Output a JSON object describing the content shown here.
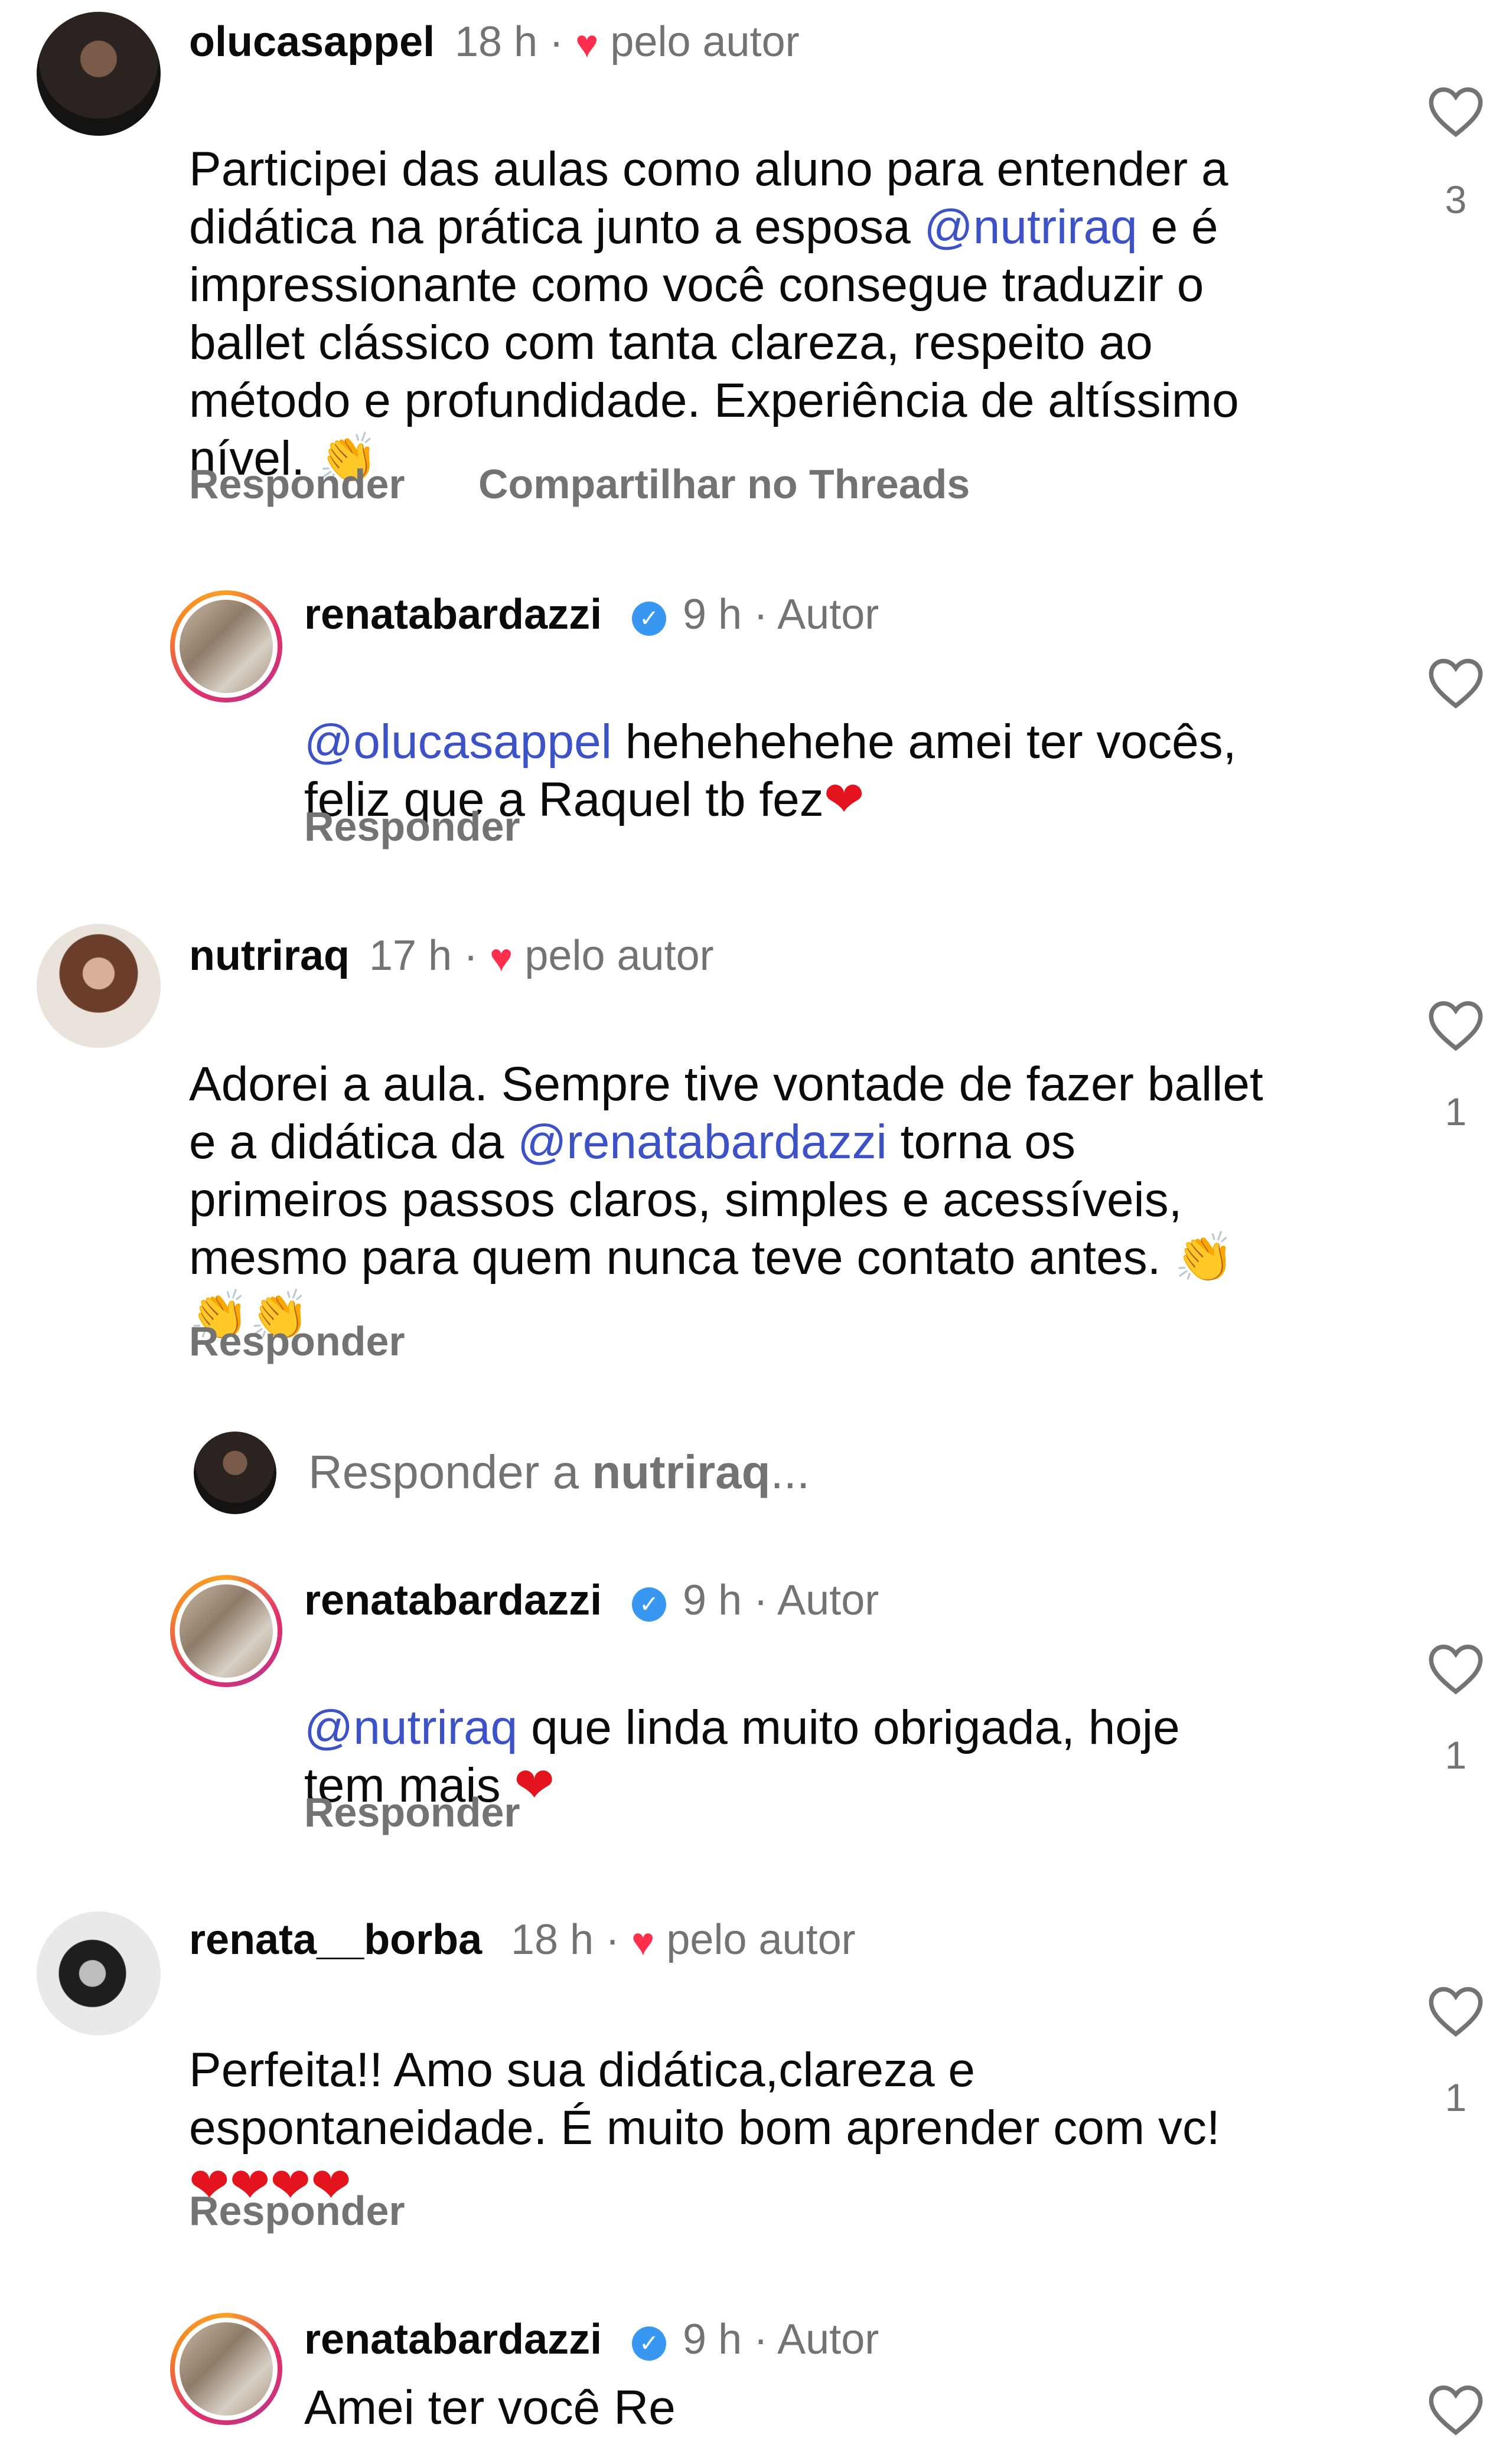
{
  "comments": [
    {
      "username": "olucasappel",
      "time": "18 h",
      "liked_by_author": "pelo autor",
      "lines": [
        "Participei das aulas como aluno para entender a",
        "didática na prática junto a esposa ",
        "impressionante como você consegue traduzir o",
        "ballet clássico com tanta clareza, respeito ao",
        "método e profundidade. Experiência de altíssimo",
        "nível. "
      ],
      "mention": "@nutriraq",
      "line2_tail": " e é",
      "emoji": "👏",
      "like_count": "3",
      "reply_label": "Responder",
      "share_label": "Compartilhar no Threads"
    },
    {
      "username": "nutriraq",
      "time": "17 h",
      "liked_by_author": "pelo autor",
      "lines": [
        "Adorei a aula. Sempre tive vontade de fazer ballet",
        "e a didática da ",
        " torna os",
        "primeiros passos claros, simples e acessíveis,",
        "mesmo para quem nunca teve contato antes. "
      ],
      "mention": "@renatabardazzi",
      "emoji": "👏",
      "emoji_line": "👏👏",
      "like_count": "1",
      "reply_label": "Responder"
    },
    {
      "username": "renata__borba",
      "time": "18 h",
      "liked_by_author": "pelo autor",
      "lines": [
        "Perfeita!! Amo sua didática,clareza e",
        "espontaneidade. É muito bom aprender com vc!"
      ],
      "hearts": "❤❤❤❤",
      "like_count": "1",
      "reply_label": "Responder"
    }
  ],
  "replies": [
    {
      "username": "renatabardazzi",
      "time": "9 h",
      "author_tag": "Autor",
      "mention": "@olucasappel",
      "line1_tail": " hehehehehe amei ter vocês,",
      "line2": "feliz que a Raquel tb fez",
      "heart": "❤",
      "reply_label": "Responder"
    },
    {
      "username": "renatabardazzi",
      "time": "9 h",
      "author_tag": "Autor",
      "mention": "@nutriraq",
      "line1_tail": " que linda muito obrigada, hoje",
      "line2": "tem mais ",
      "heart": "❤",
      "like_count": "1",
      "reply_label": "Responder"
    },
    {
      "username": "renatabardazzi",
      "time": "9 h",
      "author_tag": "Autor",
      "text": "Amei ter você Re"
    }
  ],
  "reply_input": {
    "prefix": "Responder a ",
    "target": "nutriraq",
    "suffix": "..."
  },
  "separator": "·",
  "verified_glyph": "✓"
}
